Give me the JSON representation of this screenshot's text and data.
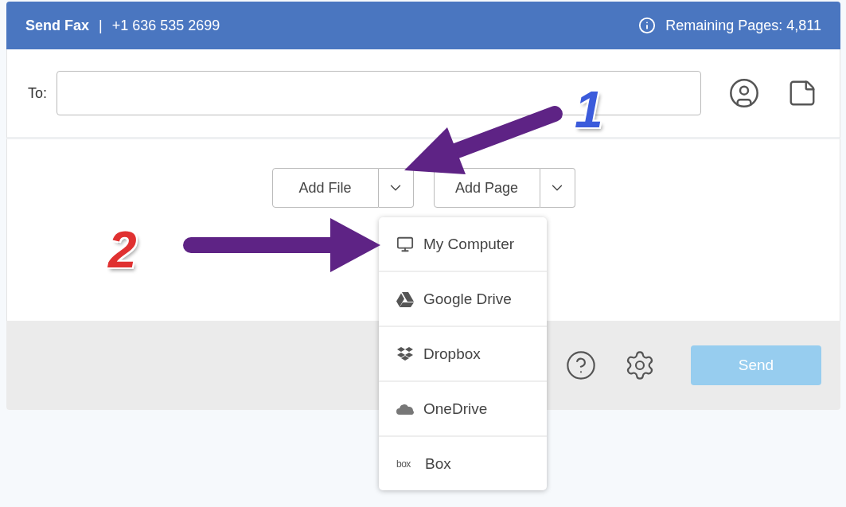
{
  "header": {
    "title": "Send Fax",
    "separator": "|",
    "number": "+1 636 535 2699",
    "remaining": "Remaining Pages: 4,811"
  },
  "recipient": {
    "label": "To:"
  },
  "actions": [
    {
      "label": "Add File"
    },
    {
      "label": "Add Page"
    }
  ],
  "dropdown": {
    "items": [
      {
        "kind": "computer",
        "label": "My Computer"
      },
      {
        "kind": "drive",
        "label": "Google Drive"
      },
      {
        "kind": "dropbox",
        "label": "Dropbox"
      },
      {
        "kind": "onedrive",
        "label": "OneDrive"
      },
      {
        "kind": "box",
        "logo": "box",
        "label": "Box"
      }
    ]
  },
  "send_button": {
    "label": "Send",
    "disabled": true
  },
  "annotations": [
    {
      "label": "1",
      "color": "#3b5bdb"
    },
    {
      "label": "2",
      "color": "#e03131"
    }
  ]
}
